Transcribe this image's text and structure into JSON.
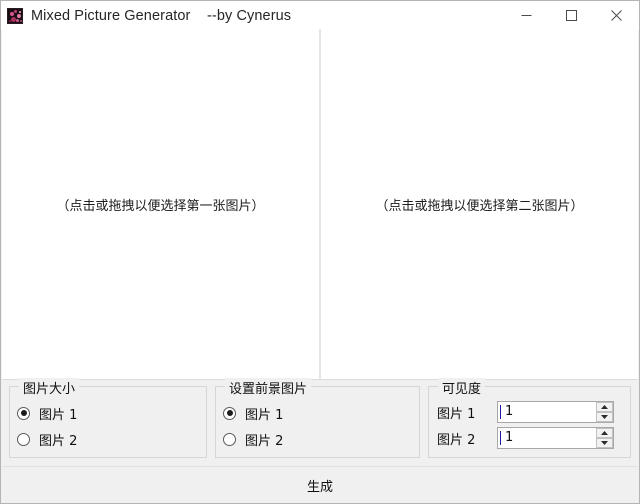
{
  "window": {
    "title": "Mixed Picture Generator    --by Cynerus",
    "icon_name": "app-thumbnail-icon",
    "controls": {
      "minimize_name": "minimize-button",
      "maximize_name": "maximize-button",
      "close_name": "close-button"
    }
  },
  "image_area": {
    "left_panel": {
      "hint": "（点击或拖拽以便选择第一张图片）"
    },
    "right_panel": {
      "hint": "（点击或拖拽以便选择第二张图片）"
    }
  },
  "groups": {
    "size": {
      "title": "图片大小",
      "options": [
        {
          "label": "图片 1",
          "selected": true
        },
        {
          "label": "图片 2",
          "selected": false
        }
      ]
    },
    "foreground": {
      "title": "设置前景图片",
      "options": [
        {
          "label": "图片 1",
          "selected": true
        },
        {
          "label": "图片 2",
          "selected": false
        }
      ]
    },
    "visibility": {
      "title": "可见度",
      "rows": [
        {
          "label": "图片 1",
          "value": "1"
        },
        {
          "label": "图片 2",
          "value": "1"
        }
      ]
    }
  },
  "footer": {
    "generate_label": "生成"
  },
  "colors": {
    "window_bg": "#f0f0f0",
    "panel_bg": "#ffffff",
    "border": "#d5d5d5",
    "text": "#101010",
    "title_text": "#262626",
    "caret": "#1a1aa0"
  }
}
